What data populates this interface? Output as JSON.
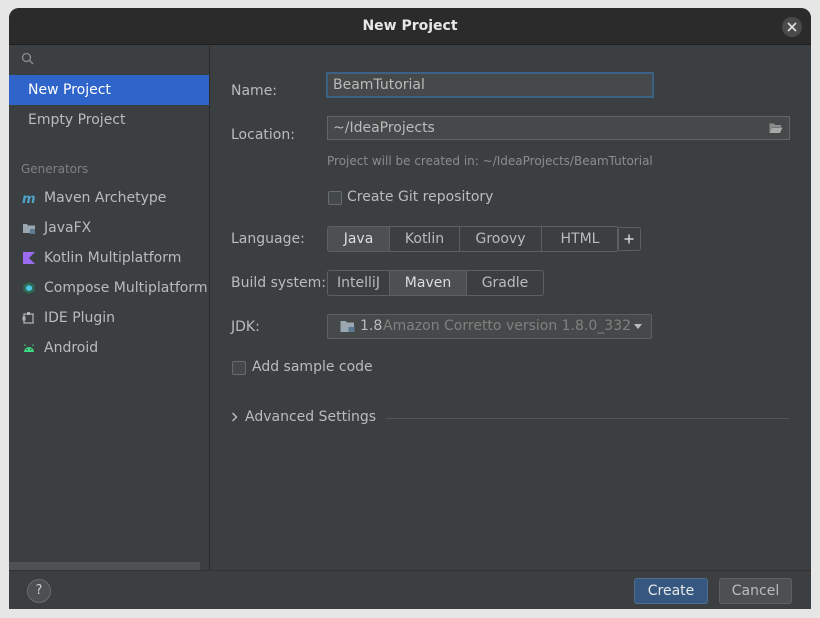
{
  "window": {
    "title": "New Project"
  },
  "sidebar": {
    "search_placeholder": "",
    "top_items": [
      {
        "label": "New Project",
        "selected": true
      },
      {
        "label": "Empty Project",
        "selected": false
      }
    ],
    "generators_label": "Generators",
    "generators": [
      {
        "label": "Maven Archetype",
        "icon": "maven-icon"
      },
      {
        "label": "JavaFX",
        "icon": "folder-icon"
      },
      {
        "label": "Kotlin Multiplatform",
        "icon": "kotlin-icon"
      },
      {
        "label": "Compose Multiplatform",
        "icon": "compose-icon"
      },
      {
        "label": "IDE Plugin",
        "icon": "plugin-icon"
      },
      {
        "label": "Android",
        "icon": "android-icon"
      }
    ]
  },
  "form": {
    "name_label": "Name:",
    "name_value": "BeamTutorial",
    "location_label": "Location:",
    "location_value": "~/IdeaProjects",
    "location_hint": "Project will be created in: ~/IdeaProjects/BeamTutorial",
    "git_label": "Create Git repository",
    "git_checked": false,
    "language_label": "Language:",
    "languages": [
      "Java",
      "Kotlin",
      "Groovy",
      "HTML"
    ],
    "language_selected": "Java",
    "build_label": "Build system:",
    "build_systems": [
      "IntelliJ",
      "Maven",
      "Gradle"
    ],
    "build_selected": "Maven",
    "jdk_label": "JDK:",
    "jdk_version": "1.8",
    "jdk_name": "Amazon Corretto version 1.8.0_332",
    "sample_label": "Add sample code",
    "sample_checked": false,
    "advanced_label": "Advanced Settings"
  },
  "footer": {
    "help_label": "?",
    "create_label": "Create",
    "cancel_label": "Cancel"
  },
  "colors": {
    "accent": "#2f65ca",
    "primary_button": "#365880",
    "background": "#3c3f41"
  }
}
